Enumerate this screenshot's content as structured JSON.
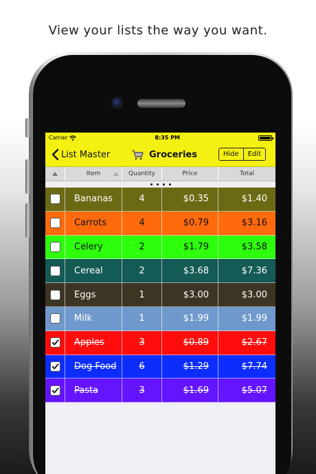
{
  "headline": "View your lists the way you want.",
  "status": {
    "carrier": "Carrier",
    "time": "8:35 PM"
  },
  "nav": {
    "back_label": "List Master",
    "title": "Groceries",
    "hide_label": "Hide",
    "edit_label": "Edit"
  },
  "columns": {
    "item": "Item",
    "quantity": "Quantity",
    "price": "Price",
    "total": "Total"
  },
  "colors": {
    "bar": "#f4f012"
  },
  "rows": [
    {
      "item": "Bananas",
      "qty": "4",
      "price": "$0.35",
      "total": "$1.40",
      "checked": false,
      "bg": "#6b6a14",
      "fg": "#ffffff"
    },
    {
      "item": "Carrots",
      "qty": "4",
      "price": "$0.79",
      "total": "$3.16",
      "checked": false,
      "bg": "#ff6a0d",
      "fg": "#111111"
    },
    {
      "item": "Celery",
      "qty": "2",
      "price": "$1.79",
      "total": "$3.58",
      "checked": false,
      "bg": "#2dff0d",
      "fg": "#111111"
    },
    {
      "item": "Cereal",
      "qty": "2",
      "price": "$3.68",
      "total": "$7.36",
      "checked": false,
      "bg": "#145a55",
      "fg": "#ffffff"
    },
    {
      "item": "Eggs",
      "qty": "1",
      "price": "$3.00",
      "total": "$3.00",
      "checked": false,
      "bg": "#3c3523",
      "fg": "#ffffff"
    },
    {
      "item": "Milk",
      "qty": "1",
      "price": "$1.99",
      "total": "$1.99",
      "checked": false,
      "bg": "#6f99cc",
      "fg": "#ffffff"
    },
    {
      "item": "Apples",
      "qty": "3",
      "price": "$0.89",
      "total": "$2.67",
      "checked": true,
      "bg": "#ff0d0d",
      "fg": "#ffffff"
    },
    {
      "item": "Dog Food",
      "qty": "6",
      "price": "$1.29",
      "total": "$7.74",
      "checked": true,
      "bg": "#0d2dff",
      "fg": "#ffffff"
    },
    {
      "item": "Pasta",
      "qty": "3",
      "price": "$1.69",
      "total": "$5.07",
      "checked": true,
      "bg": "#6414ff",
      "fg": "#ffffff"
    }
  ]
}
